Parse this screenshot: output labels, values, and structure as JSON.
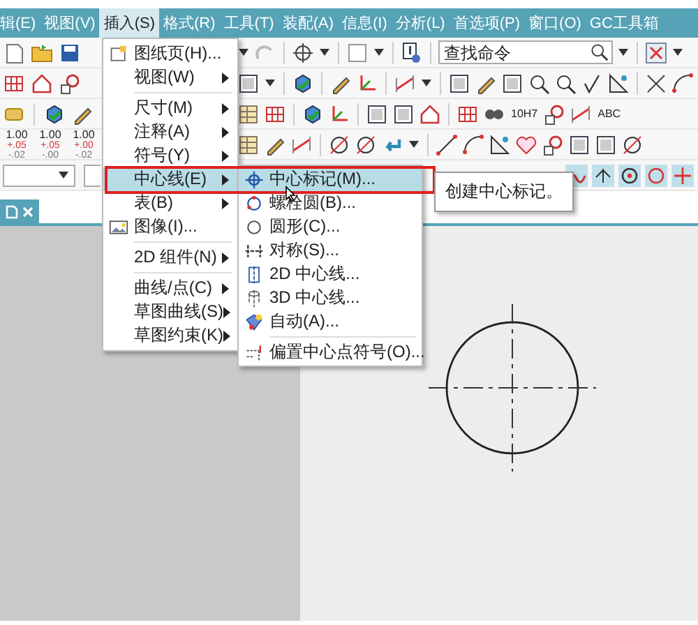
{
  "menubar": [
    {
      "label": "辑(E)",
      "selected": false
    },
    {
      "label": "视图(V)",
      "selected": false
    },
    {
      "label": "插入(S)",
      "selected": true
    },
    {
      "label": "格式(R)",
      "selected": false
    },
    {
      "label": "工具(T)",
      "selected": false
    },
    {
      "label": "装配(A)",
      "selected": false
    },
    {
      "label": "信息(I)",
      "selected": false
    },
    {
      "label": "分析(L)",
      "selected": false
    },
    {
      "label": "首选项(P)",
      "selected": false
    },
    {
      "label": "窗口(O)",
      "selected": false
    },
    {
      "label": "GC工具箱",
      "selected": false
    }
  ],
  "toolbar": {
    "search": {
      "placeholder": "查找命令"
    },
    "tolerance_icons": [
      {
        "value": "1.00",
        "upper": "+.05",
        "lower": "-.02"
      },
      {
        "value": "1.00",
        "upper": "+.05",
        "lower": "-.00"
      },
      {
        "value": "1.00",
        "upper": "+.00",
        "lower": "-.02"
      }
    ],
    "fit_label": "10H7",
    "text_dimension_label": "ABC"
  },
  "insert_menu": {
    "items": [
      {
        "kind": "command",
        "label": "图纸页(H)...",
        "selected": false
      },
      {
        "kind": "submenu",
        "label": "视图(W)",
        "selected": false
      },
      {
        "kind": "separator"
      },
      {
        "kind": "submenu",
        "label": "尺寸(M)",
        "selected": false
      },
      {
        "kind": "submenu",
        "label": "注释(A)",
        "selected": false
      },
      {
        "kind": "submenu",
        "label": "符号(Y)",
        "selected": false
      },
      {
        "kind": "submenu",
        "label": "中心线(E)",
        "selected": true
      },
      {
        "kind": "submenu",
        "label": "表(B)",
        "selected": false
      },
      {
        "kind": "command",
        "label": "图像(I)...",
        "selected": false
      },
      {
        "kind": "separator"
      },
      {
        "kind": "submenu",
        "label": "2D 组件(N)",
        "selected": false
      },
      {
        "kind": "separator"
      },
      {
        "kind": "submenu",
        "label": "曲线/点(C)",
        "selected": false
      },
      {
        "kind": "submenu",
        "label": "草图曲线(S)",
        "selected": false
      },
      {
        "kind": "submenu",
        "label": "草图约束(K)",
        "selected": false
      }
    ]
  },
  "centerline_menu": {
    "items": [
      {
        "kind": "command",
        "label": "中心标记(M)...",
        "selected": true
      },
      {
        "kind": "command",
        "label": "螺栓圆(B)...",
        "selected": false
      },
      {
        "kind": "command",
        "label": "圆形(C)...",
        "selected": false
      },
      {
        "kind": "command",
        "label": "对称(S)...",
        "selected": false
      },
      {
        "kind": "command",
        "label": "2D 中心线...",
        "selected": false
      },
      {
        "kind": "command",
        "label": "3D 中心线...",
        "selected": false
      },
      {
        "kind": "command",
        "label": "自动(A)...",
        "selected": false
      },
      {
        "kind": "separator"
      },
      {
        "kind": "command",
        "label": "偏置中心点符号(O)...",
        "selected": false
      }
    ]
  },
  "tooltip": {
    "text": "创建中心标记。"
  }
}
